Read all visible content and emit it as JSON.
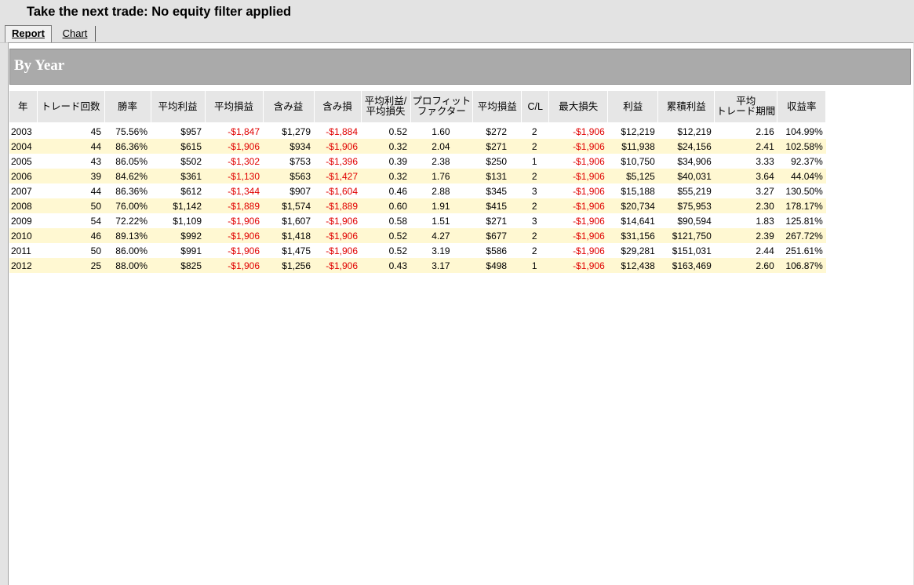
{
  "title": "Take the next trade: No equity filter applied",
  "tabs": [
    {
      "label": "Report",
      "active": true
    },
    {
      "label": "Chart",
      "active": false
    }
  ],
  "section": {
    "title": "By Year"
  },
  "colors": {
    "negative": "#e00000",
    "row_alt": "#fff8d2",
    "header_bg": "#aaaaaa"
  },
  "table": {
    "headers": [
      "年",
      "トレード回数",
      "勝率",
      "平均利益",
      "平均損益",
      "含み益",
      "含み損",
      "平均利益/平均損失",
      "プロフィット ファクター",
      "平均損益",
      "C/L",
      "最大損失",
      "利益",
      "累積利益",
      "平均 トレード期間",
      "収益率"
    ],
    "headers_html": [
      [
        "年"
      ],
      [
        "トレード回数"
      ],
      [
        "勝率"
      ],
      [
        "平均利益"
      ],
      [
        "平均損益"
      ],
      [
        "含み益"
      ],
      [
        "含み損"
      ],
      [
        "平均利益/",
        "平均損失"
      ],
      [
        "プロフィット",
        "ファクター"
      ],
      [
        "平均損益"
      ],
      [
        "C/L"
      ],
      [
        "最大損失"
      ],
      [
        "利益"
      ],
      [
        "累積利益"
      ],
      [
        "平均",
        "トレード期間"
      ],
      [
        "収益率"
      ]
    ],
    "rows": [
      [
        "2003",
        "45",
        "75.56%",
        "$957",
        "-$1,847",
        "$1,279",
        "-$1,884",
        "0.52",
        "1.60",
        "$272",
        "2",
        "-$1,906",
        "$12,219",
        "$12,219",
        "2.16",
        "104.99%"
      ],
      [
        "2004",
        "44",
        "86.36%",
        "$615",
        "-$1,906",
        "$934",
        "-$1,906",
        "0.32",
        "2.04",
        "$271",
        "2",
        "-$1,906",
        "$11,938",
        "$24,156",
        "2.41",
        "102.58%"
      ],
      [
        "2005",
        "43",
        "86.05%",
        "$502",
        "-$1,302",
        "$753",
        "-$1,396",
        "0.39",
        "2.38",
        "$250",
        "1",
        "-$1,906",
        "$10,750",
        "$34,906",
        "3.33",
        "92.37%"
      ],
      [
        "2006",
        "39",
        "84.62%",
        "$361",
        "-$1,130",
        "$563",
        "-$1,427",
        "0.32",
        "1.76",
        "$131",
        "2",
        "-$1,906",
        "$5,125",
        "$40,031",
        "3.64",
        "44.04%"
      ],
      [
        "2007",
        "44",
        "86.36%",
        "$612",
        "-$1,344",
        "$907",
        "-$1,604",
        "0.46",
        "2.88",
        "$345",
        "3",
        "-$1,906",
        "$15,188",
        "$55,219",
        "3.27",
        "130.50%"
      ],
      [
        "2008",
        "50",
        "76.00%",
        "$1,142",
        "-$1,889",
        "$1,574",
        "-$1,889",
        "0.60",
        "1.91",
        "$415",
        "2",
        "-$1,906",
        "$20,734",
        "$75,953",
        "2.30",
        "178.17%"
      ],
      [
        "2009",
        "54",
        "72.22%",
        "$1,109",
        "-$1,906",
        "$1,607",
        "-$1,906",
        "0.58",
        "1.51",
        "$271",
        "3",
        "-$1,906",
        "$14,641",
        "$90,594",
        "1.83",
        "125.81%"
      ],
      [
        "2010",
        "46",
        "89.13%",
        "$992",
        "-$1,906",
        "$1,418",
        "-$1,906",
        "0.52",
        "4.27",
        "$677",
        "2",
        "-$1,906",
        "$31,156",
        "$121,750",
        "2.39",
        "267.72%"
      ],
      [
        "2011",
        "50",
        "86.00%",
        "$991",
        "-$1,906",
        "$1,475",
        "-$1,906",
        "0.52",
        "3.19",
        "$586",
        "2",
        "-$1,906",
        "$29,281",
        "$151,031",
        "2.44",
        "251.61%"
      ],
      [
        "2012",
        "25",
        "88.00%",
        "$825",
        "-$1,906",
        "$1,256",
        "-$1,906",
        "0.43",
        "3.17",
        "$498",
        "1",
        "-$1,906",
        "$12,438",
        "$163,469",
        "2.60",
        "106.87%"
      ]
    ]
  }
}
